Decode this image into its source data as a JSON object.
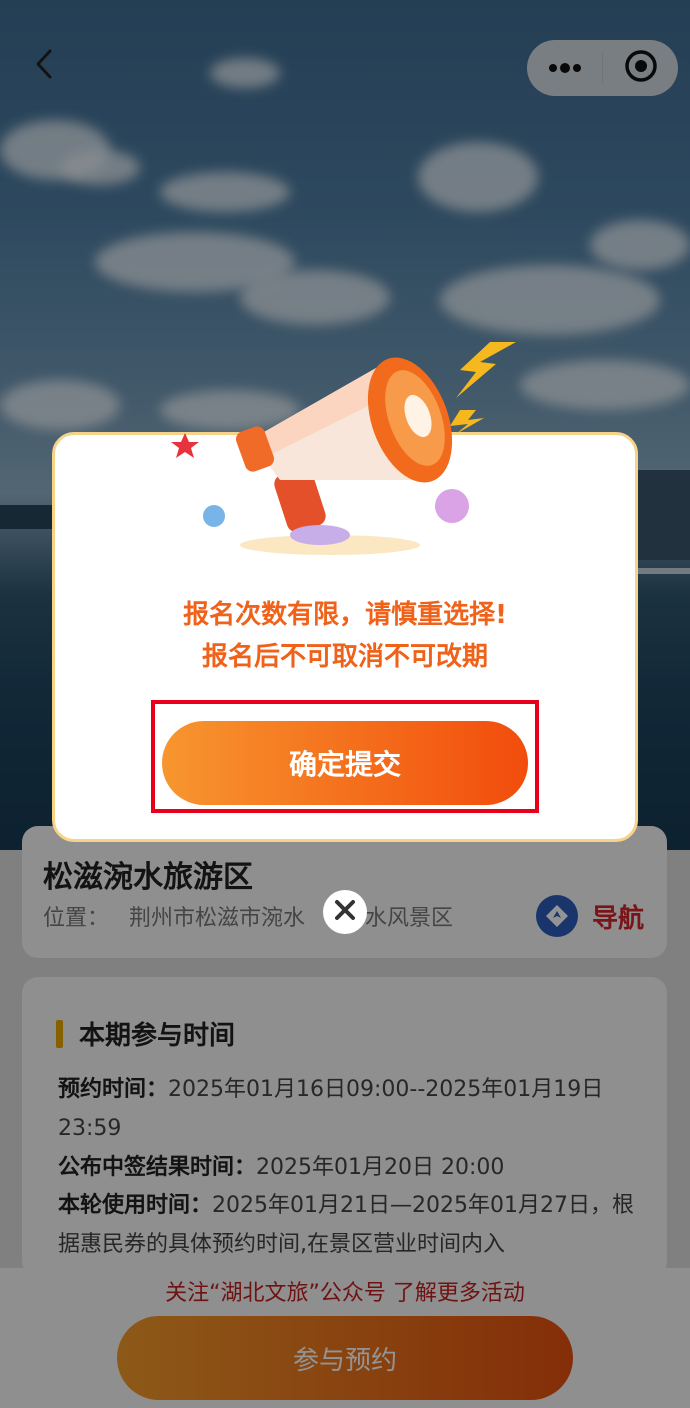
{
  "location": {
    "name": "松滋涴水旅游区",
    "address_label": "位置：",
    "address_value": "荆州市松滋市涴水",
    "address_tail": "水风景区",
    "nav_label": "导航"
  },
  "schedule": {
    "section_title": "本期参与时间",
    "booking_label": "预约时间：",
    "booking_value": "2025年01月16日09:00--2025年01月19日23:59",
    "result_label": "公布中签结果时间：",
    "result_value": "2025年01月20日 20:00",
    "use_label": "本轮使用时间：",
    "use_value": "2025年01月21日—2025年01月27日，根据惠民券的具体预约时间,在景区营业时间内入"
  },
  "footer": {
    "follow_text": "关注“湖北文旅”公众号 了解更多活动",
    "join_button": "参与预约"
  },
  "modal": {
    "message_line1": "报名次数有限，请慎重选择!",
    "message_line2": "报名后不可取消不可改期",
    "confirm_button": "确定提交"
  },
  "icons": {
    "back": "chevron-left-icon",
    "more": "more-dots-icon",
    "target": "target-circle-icon",
    "navigate": "navigation-diamond-icon",
    "close": "close-x-icon",
    "megaphone": "megaphone-icon"
  },
  "colors": {
    "accent_orange": "#f0621a",
    "button_gradient_start": "#f7962f",
    "button_gradient_end": "#f24c0c",
    "highlight_red": "#e8001a",
    "nav_red": "#d4232b"
  }
}
